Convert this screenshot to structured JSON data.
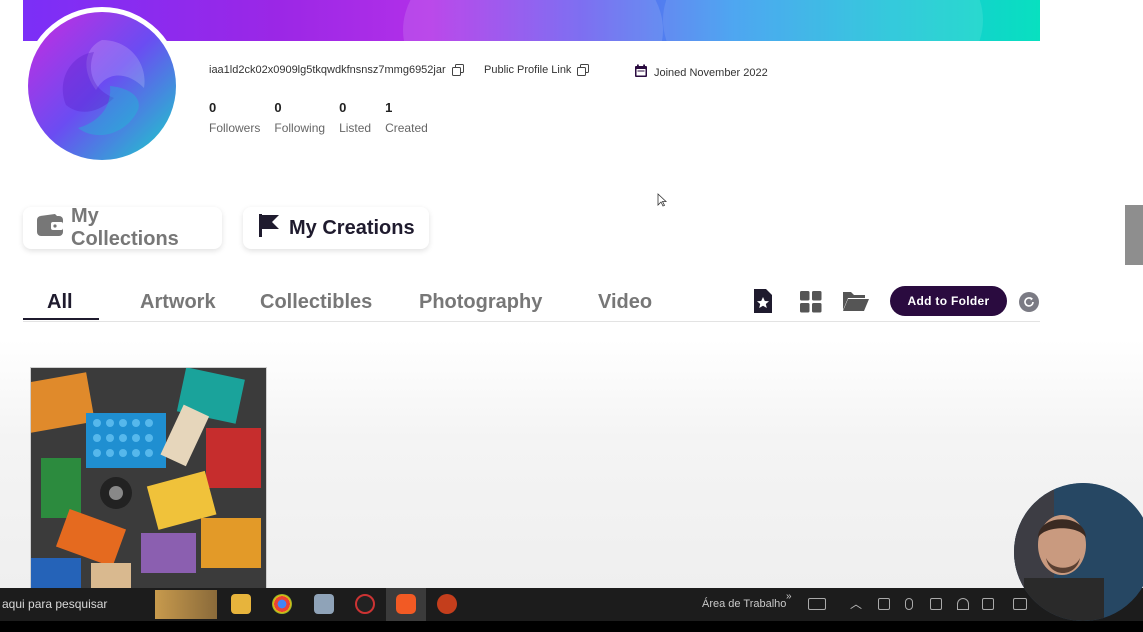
{
  "profile": {
    "wallet_address": "iaa1ld2ck02x0909lg5tkqwdkfnsnsz7mmg6952jar",
    "public_link_label": "Public Profile Link",
    "joined_label": "Joined November 2022"
  },
  "stats": [
    {
      "value": "0",
      "label": "Followers"
    },
    {
      "value": "0",
      "label": "Following"
    },
    {
      "value": "0",
      "label": "Listed"
    },
    {
      "value": "1",
      "label": "Created"
    }
  ],
  "segments": {
    "collections_label": "My Collections",
    "creations_label": "My Creations"
  },
  "tabs": [
    {
      "label": "All"
    },
    {
      "label": "Artwork"
    },
    {
      "label": "Collectibles"
    },
    {
      "label": "Photography"
    },
    {
      "label": "Video"
    }
  ],
  "toolbar": {
    "add_to_folder_label": "Add to Folder"
  },
  "taskbar": {
    "search_text": "aqui para pesquisar",
    "desktop_label": "Área de Trabalho",
    "chevron": "»"
  },
  "colors": {
    "accent": "#2a0b3f",
    "tab_active": "#1f1b2e"
  }
}
